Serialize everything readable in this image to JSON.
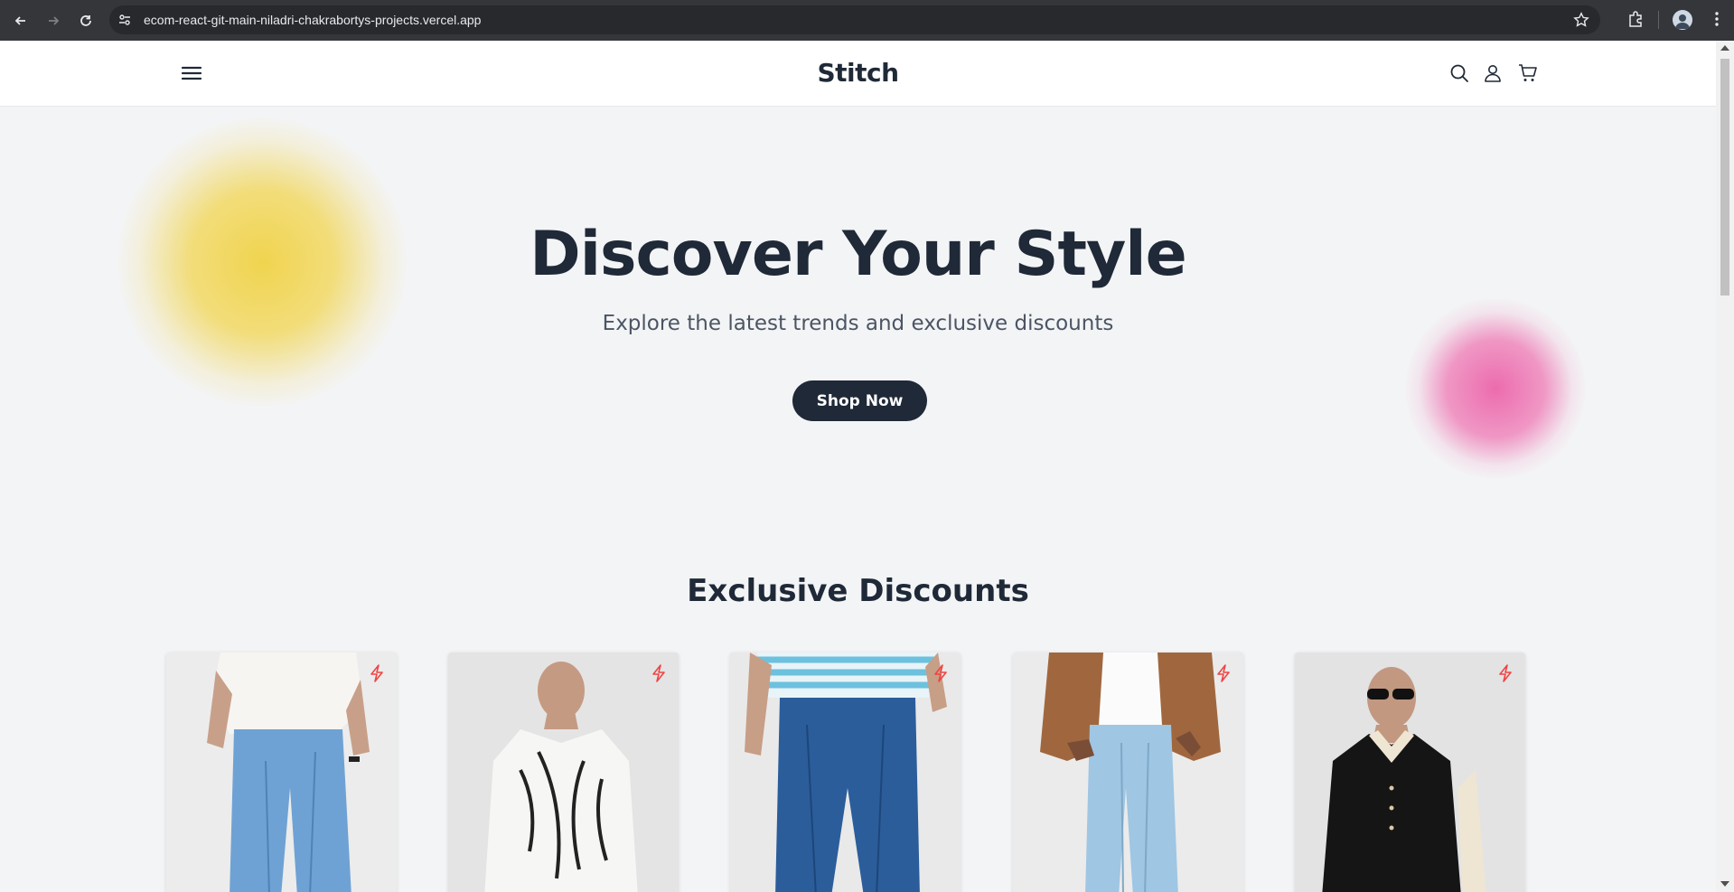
{
  "browser": {
    "url": "ecom-react-git-main-niladri-chakrabortys-projects.vercel.app"
  },
  "header": {
    "logo": "Stitch",
    "icons": [
      "menu-icon",
      "search-icon",
      "user-icon",
      "cart-icon"
    ]
  },
  "hero": {
    "title": "Discover Your Style",
    "subtitle": "Explore the latest trends and exclusive discounts",
    "cta_label": "Shop Now",
    "accent_colors": [
      "#f0d246",
      "#ec64aa"
    ]
  },
  "discounts": {
    "title": "Exclusive Discounts",
    "products": [
      {
        "image": "light-blue-baggy-jeans-white-tee",
        "badge_icon": "bolt-icon"
      },
      {
        "image": "white-patterned-shirt",
        "badge_icon": "bolt-icon"
      },
      {
        "image": "striped-sweater-dark-jeans",
        "badge_icon": "bolt-icon"
      },
      {
        "image": "brown-jacket-light-jeans",
        "badge_icon": "bolt-icon"
      },
      {
        "image": "black-knit-polo-sunglasses",
        "badge_icon": "bolt-icon"
      }
    ]
  },
  "colors": {
    "primary": "#1f2937",
    "background": "#f3f4f6",
    "badge": "#ef4444"
  }
}
